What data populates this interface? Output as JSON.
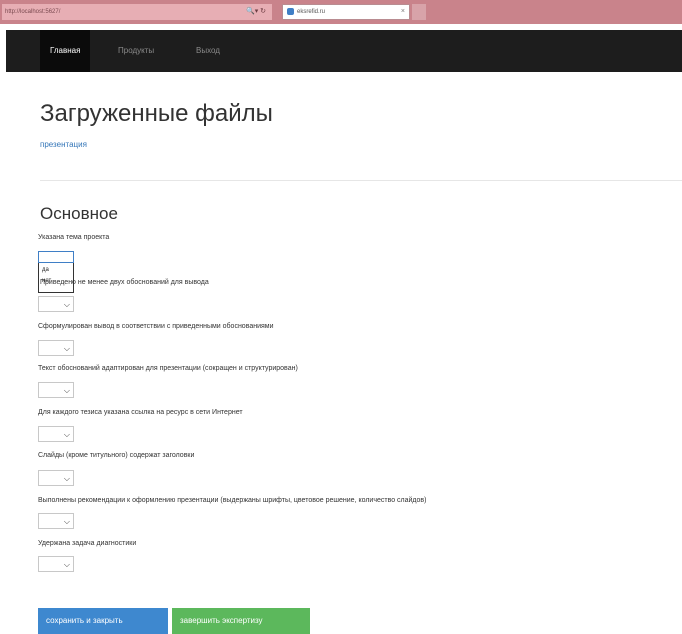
{
  "browser": {
    "address": "http://localhost:5627/",
    "tab_title": "eksrefid.ru"
  },
  "nav": {
    "home": "Главная",
    "products": "Продукты",
    "logout": "Выход"
  },
  "page": {
    "title": "Загруженные файлы",
    "file_link": "презентация",
    "section_title": "Основное"
  },
  "criteria": [
    "Указана тема проекта",
    "Приведено не менее двух обоснований для вывода",
    "Сформулирован вывод в соответствии с приведенными обоснованиями",
    "Текст обоснований адаптирован для презентации (сокращен и структурирован)",
    "Для каждого тезиса указана ссылка на ресурс в сети Интернет",
    "Слайды (кроме титульного) содержат заголовки",
    "Выполнены рекомендации к оформлению презентации (выдержаны шрифты, цветовое решение, количество слайдов)",
    "Удержана задача диагностики"
  ],
  "dropdown_options": [
    "да",
    "нет"
  ],
  "icons": {
    "chevron": "chevron-down-icon"
  },
  "buttons": {
    "save": "сохранить и закрыть",
    "finish": "завершить экспертизу"
  },
  "colors": {
    "navbar": "#1d1d1d",
    "primary": "#3e88cf",
    "success": "#5cb85c",
    "link": "#3476b8"
  }
}
